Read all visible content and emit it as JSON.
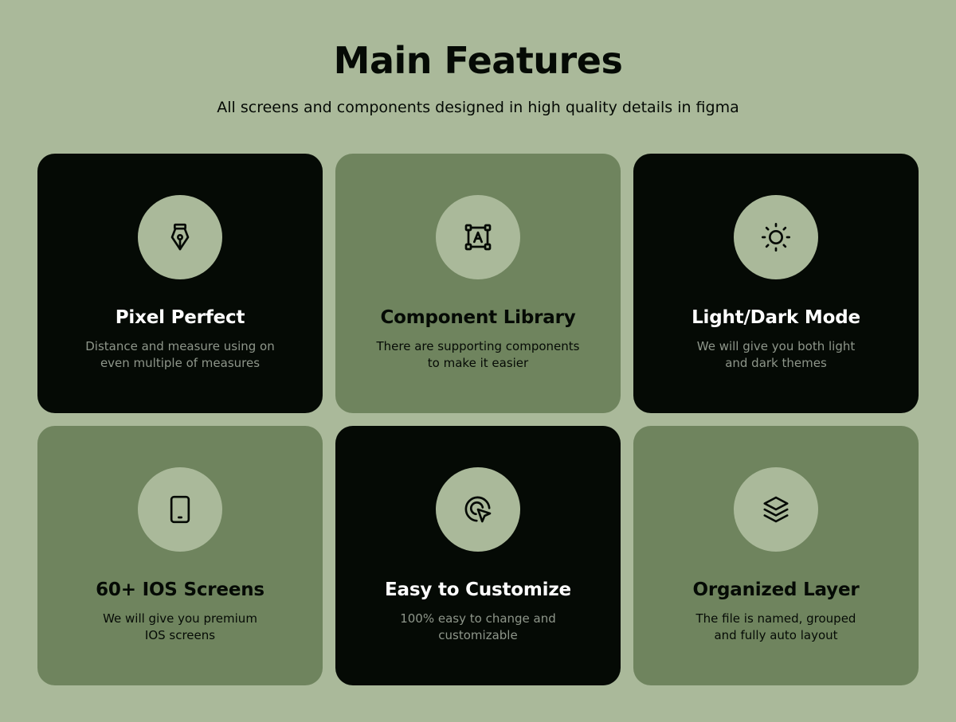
{
  "header": {
    "title": "Main Features",
    "subtitle": "All screens and components designed in high quality details in figma"
  },
  "colors": {
    "background": "#aab99a",
    "card_dark": "#050a05",
    "card_green": "#6f845e",
    "icon_circle": "#aab99a"
  },
  "features": [
    {
      "icon": "pen-tool-icon",
      "title": "Pixel Perfect",
      "desc_line1": "Distance and measure using on",
      "desc_line2": "even multiple of measures"
    },
    {
      "icon": "component-frame-icon",
      "title": "Component Library",
      "desc_line1": "There are supporting components",
      "desc_line2": "to make it easier"
    },
    {
      "icon": "sun-icon",
      "title": "Light/Dark Mode",
      "desc_line1": "We will give you both light",
      "desc_line2": "and dark themes"
    },
    {
      "icon": "tablet-icon",
      "title": "60+ IOS Screens",
      "desc_line1": "We will give you premium",
      "desc_line2": "IOS screens"
    },
    {
      "icon": "cursor-click-icon",
      "title": "Easy to Customize",
      "desc_line1": "100% easy to change and",
      "desc_line2": "customizable"
    },
    {
      "icon": "layers-icon",
      "title": "Organized Layer",
      "desc_line1": "The file is named, grouped",
      "desc_line2": "and fully auto layout"
    }
  ]
}
